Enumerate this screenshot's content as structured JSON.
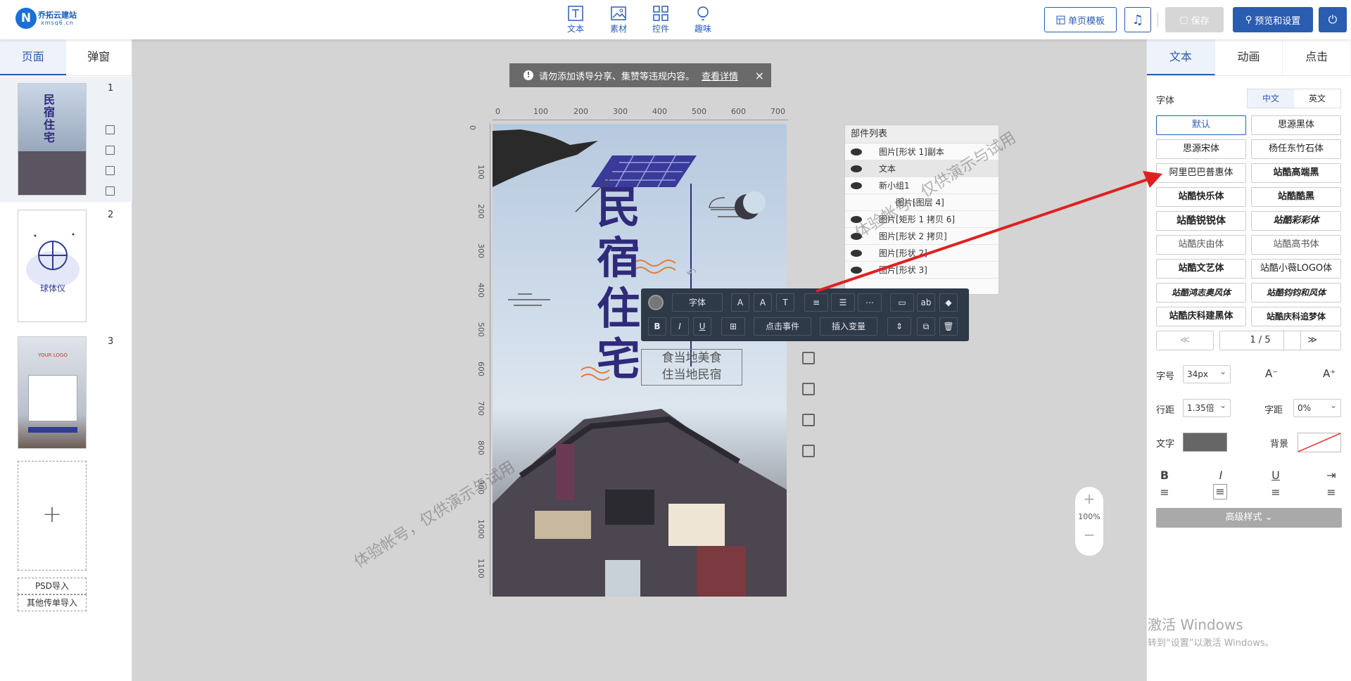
{
  "app": {
    "logo_name": "乔拓云建站",
    "logo_domain": "xmsq6.cn",
    "logo_letter": "N"
  },
  "toolbar": {
    "tools": [
      {
        "label": "文本",
        "icon": "text-icon"
      },
      {
        "label": "素材",
        "icon": "image-icon"
      },
      {
        "label": "控件",
        "icon": "widgets-icon"
      },
      {
        "label": "趣味",
        "icon": "bulb-icon"
      }
    ],
    "single_page_template": "单页模板",
    "save": "保存",
    "preview_settings": "预览和设置"
  },
  "left": {
    "tabs": [
      "页面",
      "弹窗"
    ],
    "active_tab": "页面",
    "pages": [
      {
        "num": "1"
      },
      {
        "num": "2",
        "caption": "球体仪"
      },
      {
        "num": "3",
        "logo": "YOUR LOGO"
      }
    ],
    "psd_import": "PSD导入",
    "other_import": "其他传单导入"
  },
  "notice": {
    "text": "请勿添加诱导分享、集赞等违规内容。",
    "link": "查看详情",
    "close": "×"
  },
  "ruler": {
    "top": [
      "0",
      "100",
      "200",
      "300",
      "400",
      "500",
      "600",
      "700"
    ],
    "left": [
      "0",
      "100",
      "200",
      "300",
      "400",
      "500",
      "600",
      "700",
      "800",
      "900",
      "1000",
      "1100"
    ]
  },
  "canvas": {
    "title_chars": [
      "民",
      "宿",
      "住",
      "宅"
    ],
    "textbox_lines": [
      "食当地美食",
      "住当地民宿"
    ]
  },
  "components": {
    "title": "部件列表",
    "rows": [
      "图片[形状 1]副本",
      "文本",
      "新小组1",
      "图片[图层 4]",
      "图片[矩形 1 拷贝 6]",
      "图片[形状 2 拷贝]",
      "图片[形状 2]",
      "图片[形状 3]"
    ]
  },
  "floatbar": {
    "font": "字体",
    "click_event": "点击事件",
    "insert_var": "插入变量",
    "bold": "B",
    "italic": "I",
    "underline": "U"
  },
  "zoom": {
    "plus": "+",
    "level": "100%",
    "minus": "−"
  },
  "right": {
    "tabs": [
      "文本",
      "动画",
      "点击"
    ],
    "active_tab": "文本",
    "font_label": "字体",
    "lang_options": [
      "中文",
      "英文"
    ],
    "fonts": [
      "默认",
      "思源黑体",
      "思源宋体",
      "杨任东竹石体",
      "阿里巴巴普惠体",
      "站酷高端黑",
      "站酷快乐体",
      "站酷酷黑",
      "站酷锐锐体",
      "站酷彩彩体",
      "站酷庆由体",
      "站酷高书体",
      "站酷文艺体",
      "站酷小薇LOGO体",
      "站酷鸿志奥风体",
      "站酷钧钧和风体",
      "站酷庆科建黑体",
      "站酷庆科追梦体"
    ],
    "pager": {
      "prev": "≪",
      "page": "1 / 5",
      "next": "≫"
    },
    "size_label": "字号",
    "size_value": "34px",
    "size_down": "A⁻",
    "size_up": "A⁺",
    "line_height_label": "行距",
    "line_height_value": "1.35倍",
    "spacing_label": "字距",
    "spacing_value": "0%",
    "text_color_label": "文字",
    "text_color": "#666666",
    "bg_label": "背景",
    "format": [
      "B",
      "I",
      "U",
      "⇥"
    ],
    "advanced": "高级样式 ⌄"
  },
  "watermarks": [
    "体验帐号，仅供演示与试用",
    "体验帐号，仅供演示与试用"
  ],
  "windows": {
    "title": "激活 Windows",
    "sub": "转到“设置”以激活 Windows。"
  }
}
